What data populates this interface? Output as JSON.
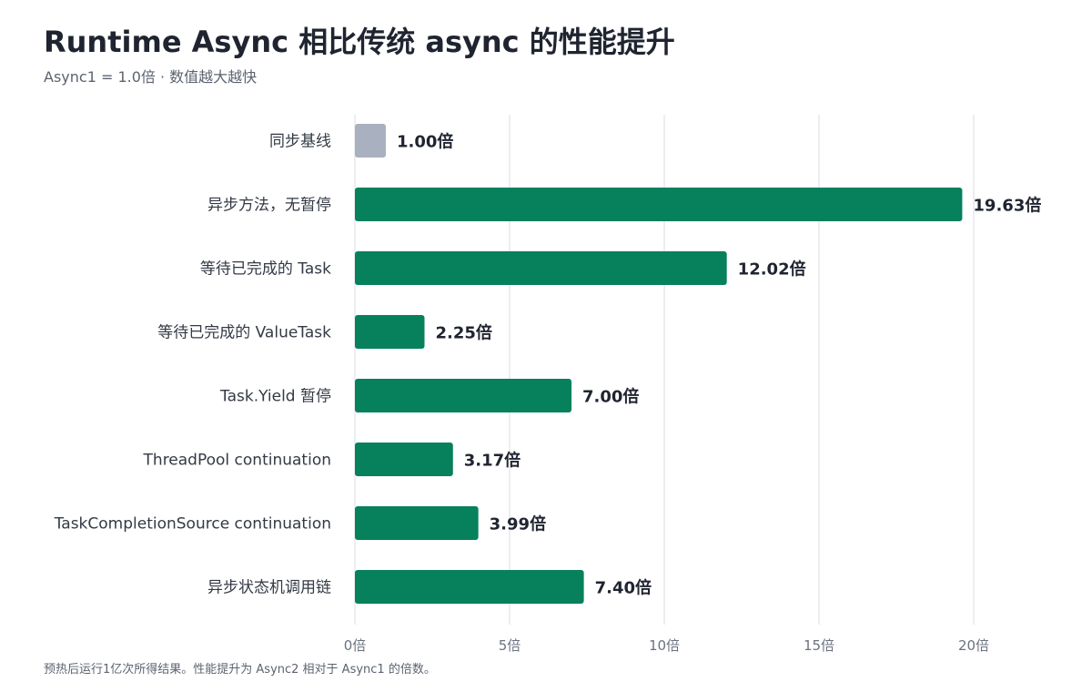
{
  "header": {
    "title": "Runtime Async 相比传统 async 的性能提升",
    "subtitle": "Async1 = 1.0倍 · 数值越大越快"
  },
  "footer": {
    "note": "预热后运行1亿次所得结果。性能提升为 Async2 相对于 Async1 的倍数。"
  },
  "colors": {
    "baseline": "#a9b0bf",
    "bar": "#07805c",
    "grid": "#e6e8ec"
  },
  "chart_data": {
    "type": "bar",
    "orientation": "horizontal",
    "title": "Runtime Async 相比传统 async 的性能提升",
    "subtitle": "Async1 = 1.0倍 · 数值越大越快",
    "categories": [
      "同步基线",
      "异步方法，无暂停",
      "等待已完成的 Task",
      "等待已完成的 ValueTask",
      "Task.Yield 暂停",
      "ThreadPool continuation",
      "TaskCompletionSource continuation",
      "异步状态机调用链"
    ],
    "values": [
      1.0,
      19.63,
      12.02,
      2.25,
      7.0,
      3.17,
      3.99,
      7.4
    ],
    "value_labels": [
      "1.00倍",
      "19.63倍",
      "12.02倍",
      "2.25倍",
      "7.00倍",
      "3.17倍",
      "3.99倍",
      "7.40倍"
    ],
    "xlim": [
      0,
      20
    ],
    "xticks": [
      0,
      5,
      10,
      15,
      20
    ],
    "xtick_labels": [
      "0倍",
      "5倍",
      "10倍",
      "15倍",
      "20倍"
    ],
    "grid": true,
    "legend": "none"
  }
}
